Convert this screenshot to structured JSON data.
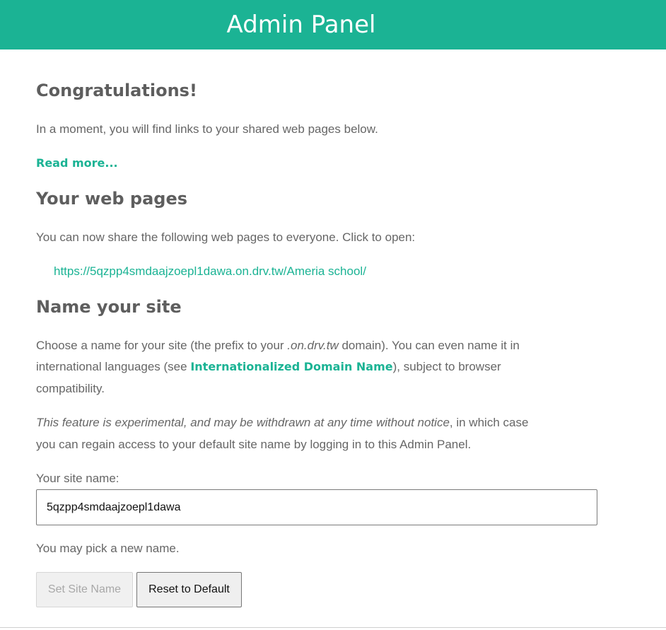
{
  "header": {
    "title": "Admin Panel"
  },
  "congrats": {
    "heading": "Congratulations!",
    "text": "In a moment, you will find links to your shared web pages below.",
    "read_more": "Read more..."
  },
  "web_pages": {
    "heading": "Your web pages",
    "text": "You can now share the following web pages to everyone. Click to open:",
    "links": [
      "https://5qzpp4smdaajzoepl1dawa.on.drv.tw/Ameria school/"
    ]
  },
  "name_site": {
    "heading": "Name your site",
    "p1_part1": "Choose a name for your site (the prefix to your ",
    "p1_domain": ".on.drv.tw",
    "p1_part2": " domain). You can even name it in",
    "p1_line2_part1": "international languages (see ",
    "p1_idn_link": "Internationalized Domain Name",
    "p1_line2_part2": "), subject to browser",
    "p1_line3": "compatibility.",
    "p2_italic": "This feature is experimental, and may be withdrawn at any time without notice",
    "p2_part1": ", in which case",
    "p2_line2": "you can regain access to your default site name by logging in to this Admin Panel.",
    "label": "Your site name:",
    "input_value": "5qzpp4smdaajzoepl1dawa",
    "hint": "You may pick a new name.",
    "set_button": "Set Site Name",
    "reset_button": "Reset to Default"
  },
  "colors": {
    "accent": "#1bb394",
    "text": "#666666",
    "heading": "#5e5e5e"
  }
}
